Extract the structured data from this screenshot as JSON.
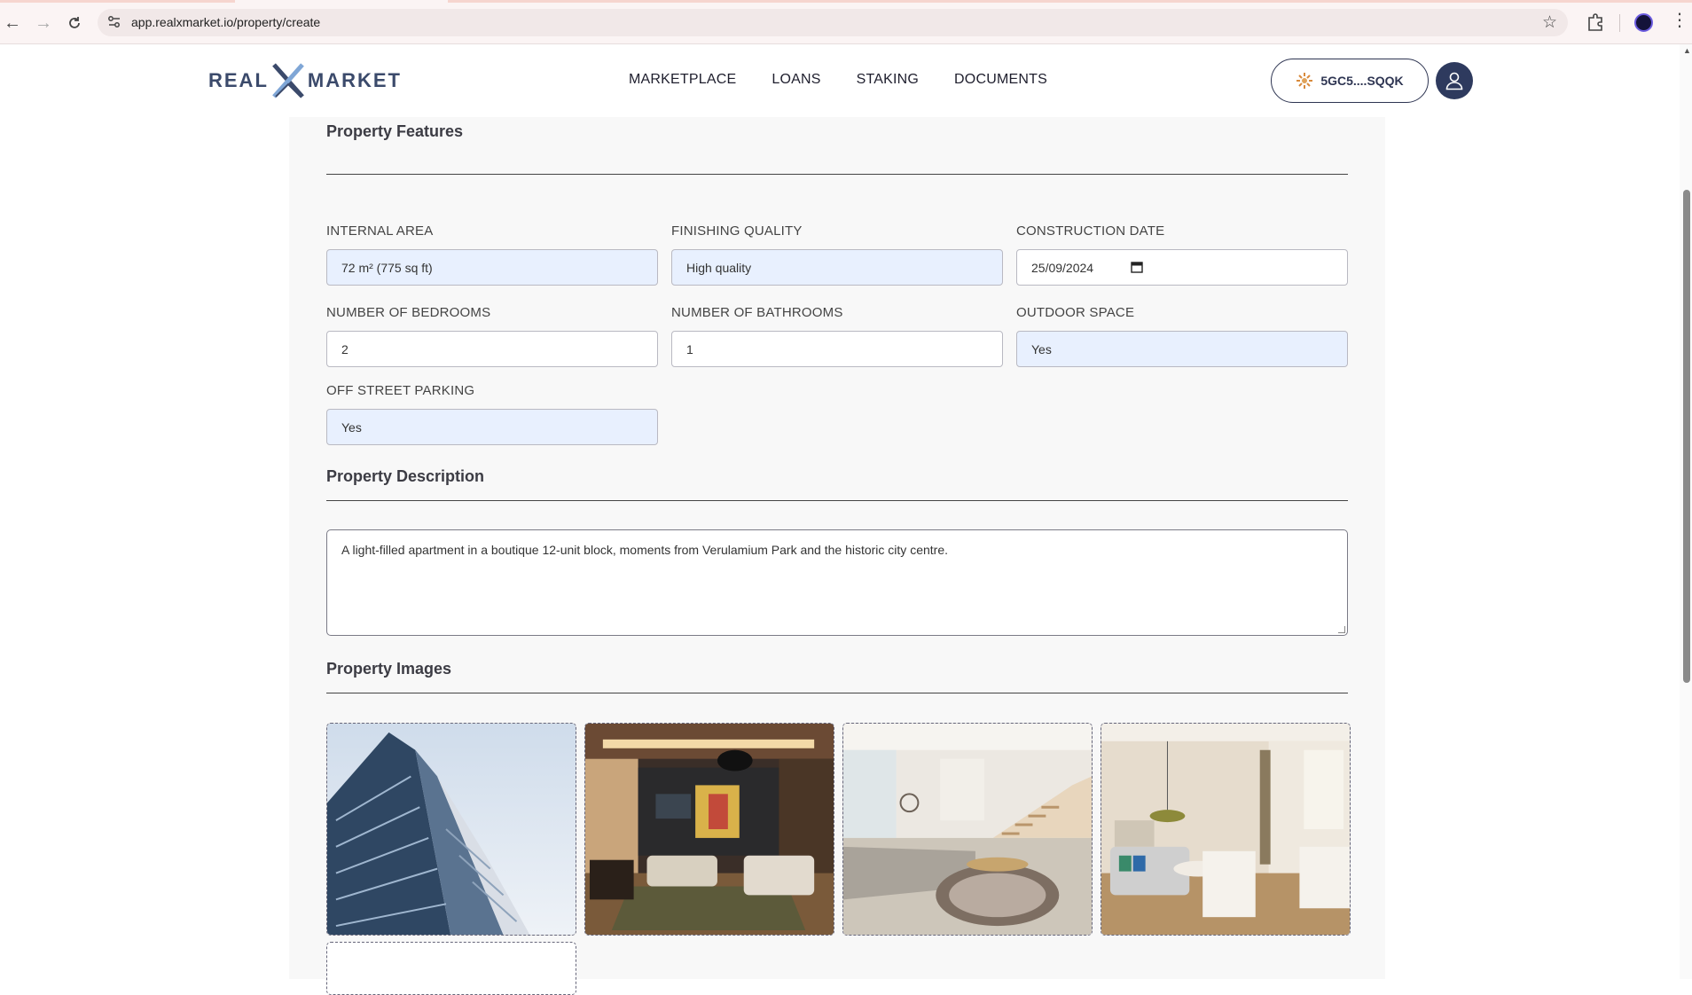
{
  "browser": {
    "url": "app.realxmarket.io/property/create"
  },
  "header": {
    "logo_left": "REAL",
    "logo_right": "MARKET",
    "nav": [
      "MARKETPLACE",
      "LOANS",
      "STAKING",
      "DOCUMENTS"
    ],
    "wallet_address": "5GC5....SQQK"
  },
  "features": {
    "title": "Property Features",
    "internal_area": {
      "label": "INTERNAL AREA",
      "value": "72 m² (775 sq ft)"
    },
    "finishing_quality": {
      "label": "FINISHING QUALITY",
      "value": "High quality"
    },
    "construction_date": {
      "label": "CONSTRUCTION DATE",
      "value": "25/09/2024"
    },
    "bedrooms": {
      "label": "NUMBER OF BEDROOMS",
      "value": "2"
    },
    "bathrooms": {
      "label": "NUMBER OF BATHROOMS",
      "value": "1"
    },
    "outdoor_space": {
      "label": "OUTDOOR SPACE",
      "value": "Yes"
    },
    "parking": {
      "label": "OFF STREET PARKING",
      "value": "Yes"
    }
  },
  "description": {
    "title": "Property Description",
    "text": "A light-filled apartment in a boutique 12-unit block, moments from Verulamium Park and the historic city centre."
  },
  "images": {
    "title": "Property Images"
  }
}
